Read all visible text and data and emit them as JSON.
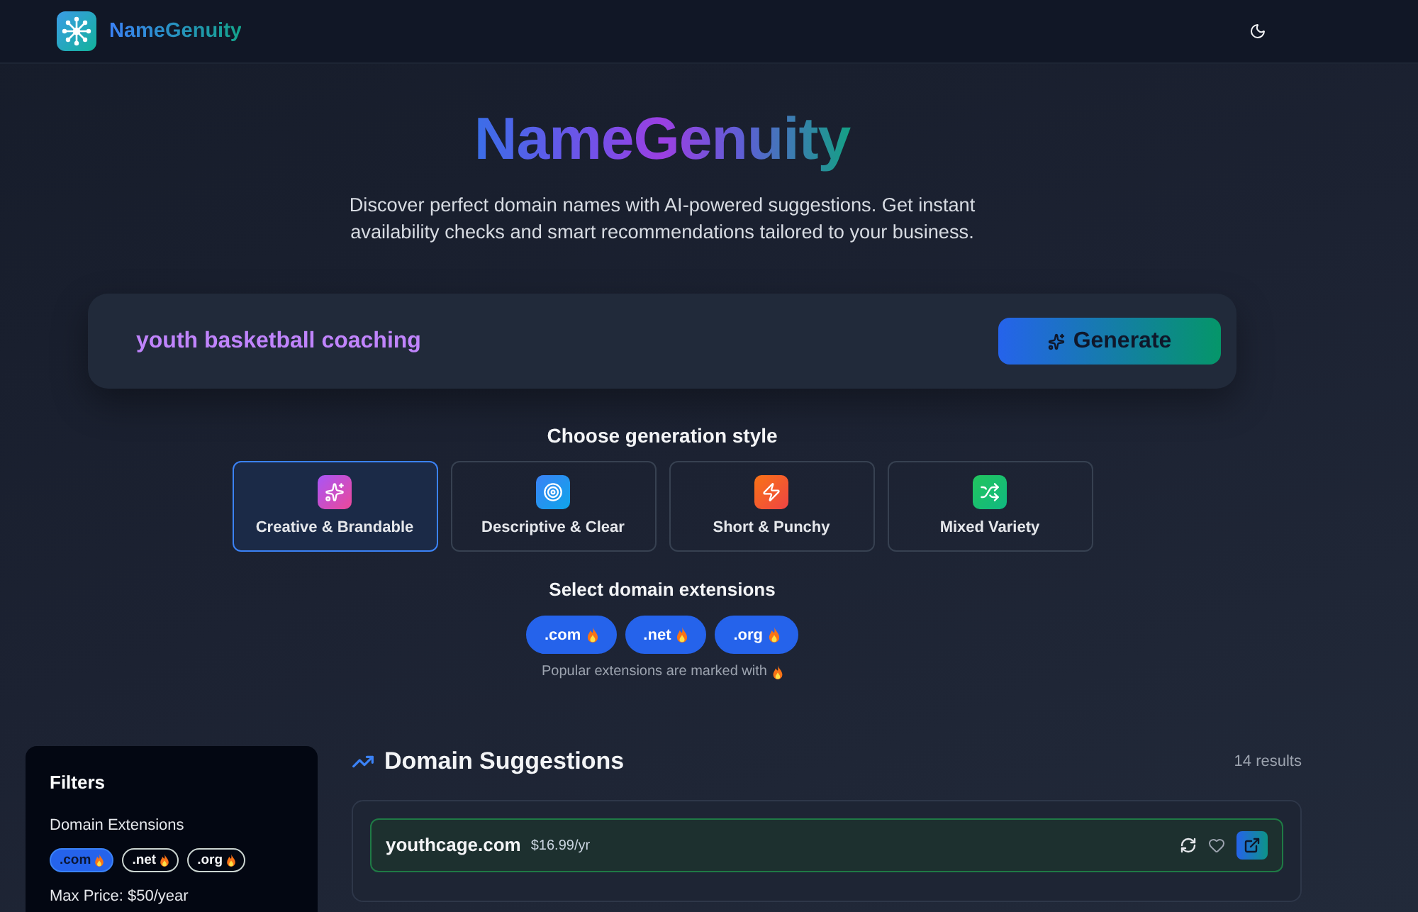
{
  "header": {
    "brand": "NameGenuity"
  },
  "hero": {
    "title": "NameGenuity",
    "subtitle": "Discover perfect domain names with AI-powered suggestions. Get instant availability checks and smart recommendations tailored to your business."
  },
  "search": {
    "value": "youth basketball coaching",
    "button": "Generate"
  },
  "generation_style": {
    "heading": "Choose generation style",
    "options": [
      {
        "label": "Creative & Brandable",
        "kind": "creative",
        "selected": true
      },
      {
        "label": "Descriptive & Clear",
        "kind": "descriptive",
        "selected": false
      },
      {
        "label": "Short & Punchy",
        "kind": "short",
        "selected": false
      },
      {
        "label": "Mixed Variety",
        "kind": "mixed",
        "selected": false
      }
    ]
  },
  "extensions": {
    "heading": "Select domain extensions",
    "chips": [
      {
        "label": ".com",
        "selected": true,
        "popular": true
      },
      {
        "label": ".net",
        "selected": true,
        "popular": true
      },
      {
        "label": ".org",
        "selected": true,
        "popular": true
      }
    ],
    "note": "Popular extensions are marked with"
  },
  "filters": {
    "title": "Filters",
    "extensions_label": "Domain Extensions",
    "chips": [
      {
        "label": ".com",
        "selected": true,
        "popular": true
      },
      {
        "label": ".net",
        "selected": false,
        "popular": true
      },
      {
        "label": ".org",
        "selected": false,
        "popular": true
      }
    ],
    "max_price": "Max Price: $50/year"
  },
  "results": {
    "title": "Domain Suggestions",
    "count": "14 results",
    "items": [
      {
        "domain": "youthcage.com",
        "price": "$16.99/yr",
        "available": true,
        "favorite": false
      }
    ]
  }
}
